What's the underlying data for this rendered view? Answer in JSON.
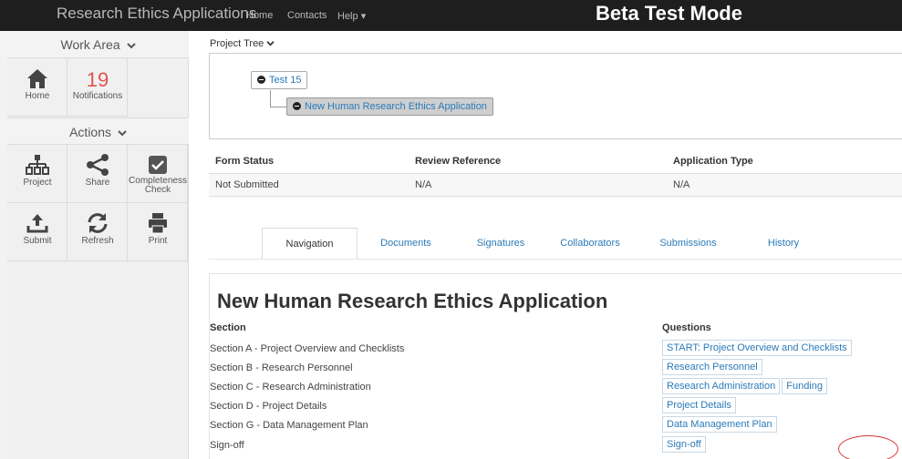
{
  "nav": {
    "brand": "Research Ethics Applications",
    "home": "Home",
    "contacts": "Contacts",
    "help": "Help",
    "help_caret": "▾",
    "beta": "Beta Test Mode"
  },
  "sidebar": {
    "work_area": "Work Area",
    "actions": "Actions",
    "caret": "⌄",
    "tiles": {
      "home": {
        "label": "Home",
        "icon": "home-icon"
      },
      "notifications": {
        "label": "Notifications",
        "count": "19"
      },
      "project": {
        "label": "Project",
        "icon": "sitemap-icon"
      },
      "share": {
        "label": "Share",
        "icon": "share-icon"
      },
      "completeness": {
        "label1": "Completeness",
        "label2": "Check",
        "icon": "check-square-icon"
      },
      "submit": {
        "label": "Submit",
        "icon": "upload-icon"
      },
      "refresh": {
        "label": "Refresh",
        "icon": "refresh-icon"
      },
      "print": {
        "label": "Print",
        "icon": "print-icon"
      }
    }
  },
  "main": {
    "project_tree_label": "Project Tree",
    "tree": {
      "root": "Test 15",
      "child": "New Human Research Ethics Application"
    },
    "status": {
      "headers": [
        "Form Status",
        "Review Reference",
        "Application Type"
      ],
      "values": [
        "Not Submitted",
        "N/A",
        "N/A"
      ]
    },
    "tabs": [
      "Navigation",
      "Documents",
      "Signatures",
      "Collaborators",
      "Submissions",
      "History"
    ],
    "title": "New Human Research Ethics Application",
    "section_header": "Section",
    "questions_header": "Questions",
    "sections": [
      {
        "label": "Section A - Project Overview and Checklists",
        "links": [
          "START: Project Overview and Checklists"
        ]
      },
      {
        "label": "Section B - Research Personnel",
        "links": [
          "Research Personnel"
        ]
      },
      {
        "label": "Section C - Research Administration",
        "links": [
          "Research Administration",
          "Funding"
        ]
      },
      {
        "label": "Section D - Project Details",
        "links": [
          "Project Details"
        ]
      },
      {
        "label": "Section G - Data Management Plan",
        "links": [
          "Data Management Plan"
        ]
      },
      {
        "label": "Sign-off",
        "links": [
          "Sign-off"
        ]
      }
    ]
  },
  "colors": {
    "topbar": "#1e1e1e",
    "link": "#2a7ab8",
    "notification": "#e0554e",
    "highlight_circle": "#d83a3a"
  }
}
